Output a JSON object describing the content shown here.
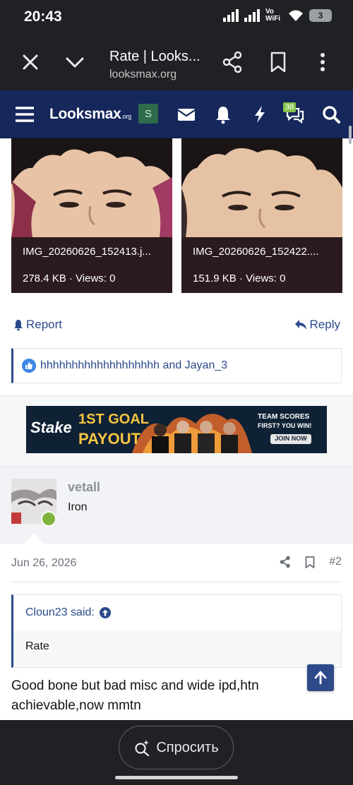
{
  "status_bar": {
    "time": "20:43",
    "network_label": "Vo WiFi",
    "battery": "3"
  },
  "browser": {
    "tab_title": "Rate | Looks...",
    "url": "looksmax.org"
  },
  "site_nav": {
    "logo_main": "Looksmax",
    "logo_suffix": ".org",
    "s_label": "S",
    "conversations_badge": "38"
  },
  "attachments": [
    {
      "filename": "IMG_20260626_152413.j...",
      "size": "278.4 KB",
      "views": "Views: 0"
    },
    {
      "filename": "IMG_20260626_152422....",
      "size": "151.9 KB",
      "views": "Views: 0"
    }
  ],
  "post_actions": {
    "report": "Report",
    "reply": "Reply"
  },
  "reactions": {
    "text": "hhhhhhhhhhhhhhhhhhh and Jayan_3"
  },
  "ad": {
    "brand": "Stake",
    "headline_1": "1ST GOAL",
    "headline_2": "PAYOUT",
    "side_1": "TEAM SCORES",
    "side_2": "FIRST? YOU WIN!",
    "cta": "JOIN NOW"
  },
  "post": {
    "username": "vetall",
    "user_title": "Iron",
    "date": "Jun 26, 2026",
    "number": "#2",
    "quote_author": "Cloun23 said:",
    "quote_text": "Rate",
    "body": "Good bone but bad misc and wide ipd,htn achievable,now mmtn"
  },
  "bottom": {
    "ask_label": "Спросить"
  },
  "colors": {
    "nav_bg": "#15275b",
    "link": "#2b4a8b",
    "online": "#7fb33c",
    "scroll_top": "#2f4a8a"
  }
}
